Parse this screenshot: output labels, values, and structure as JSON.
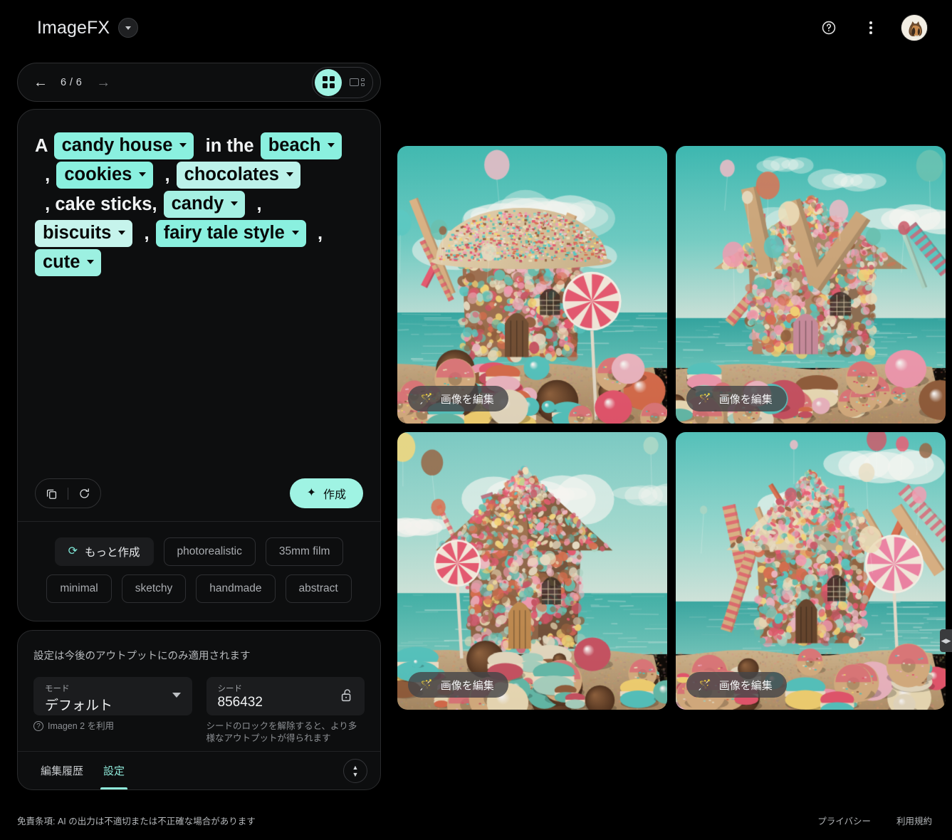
{
  "header": {
    "brand": "ImageFX",
    "brand_caret_icon": "chevron-down-icon",
    "help_icon": "help-circle-icon",
    "more_icon": "more-vertical-icon",
    "avatar_icon": "user-avatar-cat"
  },
  "nav": {
    "back_icon": "arrow-left-icon",
    "forward_icon": "arrow-right-icon",
    "page_count": "6 / 6",
    "grid_view_icon": "grid-view-icon",
    "detail_view_icon": "detail-view-icon"
  },
  "prompt": {
    "tokens": [
      {
        "kind": "text",
        "text": "A "
      },
      {
        "kind": "chip",
        "text": "candy house",
        "color": "#8af0df"
      },
      {
        "kind": "text",
        "text": "  in the "
      },
      {
        "kind": "chip",
        "text": "beach",
        "color": "#8af0df"
      },
      {
        "kind": "text",
        "text": "  , "
      },
      {
        "kind": "chip",
        "text": "cookies",
        "color": "#8af0df"
      },
      {
        "kind": "text",
        "text": "  , "
      },
      {
        "kind": "chip",
        "text": "chocolates",
        "color": "#bcf2ea"
      },
      {
        "kind": "text",
        "text": "  , cake sticks, "
      },
      {
        "kind": "chip",
        "text": "candy",
        "color": "#a5f0e3"
      },
      {
        "kind": "text",
        "text": "  , "
      },
      {
        "kind": "chip",
        "text": "biscuits",
        "color": "#c6f4ec"
      },
      {
        "kind": "text",
        "text": "  , "
      },
      {
        "kind": "chip",
        "text": "fairy tale style",
        "color": "#8af0df"
      },
      {
        "kind": "text",
        "text": "  , "
      },
      {
        "kind": "chip",
        "text": "cute",
        "color": "#9cf0e1"
      }
    ],
    "copy_icon": "copy-icon",
    "reset_icon": "refresh-icon",
    "create_label": "作成",
    "create_icon": "sparkle-icon"
  },
  "suggestions": [
    {
      "label": "もっと作成",
      "icon": "refresh-icon",
      "primary": true
    },
    {
      "label": "photorealistic",
      "primary": false
    },
    {
      "label": "35mm film",
      "primary": false
    },
    {
      "label": "minimal",
      "primary": false
    },
    {
      "label": "sketchy",
      "primary": false
    },
    {
      "label": "handmade",
      "primary": false
    },
    {
      "label": "abstract",
      "primary": false
    }
  ],
  "settings": {
    "note": "設定は今後のアウトプットにのみ適用されます",
    "mode_label": "モード",
    "mode_value": "デフォルト",
    "mode_hint": "Imagen 2 を利用",
    "mode_hint_icon": "help-circle-icon",
    "seed_label": "シード",
    "seed_value": "856432",
    "seed_lock_icon": "lock-open-icon",
    "seed_hint": "シードのロックを解除すると、より多様なアウトプットが得られます",
    "tabs": [
      {
        "label": "編集履歴",
        "active": false
      },
      {
        "label": "設定",
        "active": true
      }
    ],
    "expand_icon": "expand-collapse-icon"
  },
  "gallery": {
    "edit_label": "画像を編集",
    "edit_icon": "magic-wand-icon",
    "tiles": [
      {
        "id": "tile-1",
        "alt": "sprinkle-domed candy house on beach with lollipop and donuts"
      },
      {
        "id": "tile-2",
        "alt": "cookie-stick roofed candy house on beach with balloons"
      },
      {
        "id": "tile-3",
        "alt": "gingerbread cottage with macarons and swirl lollipop"
      },
      {
        "id": "tile-4",
        "alt": "candy cottage with striped candy canes and lollipops"
      }
    ],
    "side_handle_icon": "collapse-panel-icon"
  },
  "footer": {
    "disclaimer": "免責条項: AI の出力は不適切または不正確な場合があります",
    "links": [
      "プライバシー",
      "利用規約"
    ]
  }
}
